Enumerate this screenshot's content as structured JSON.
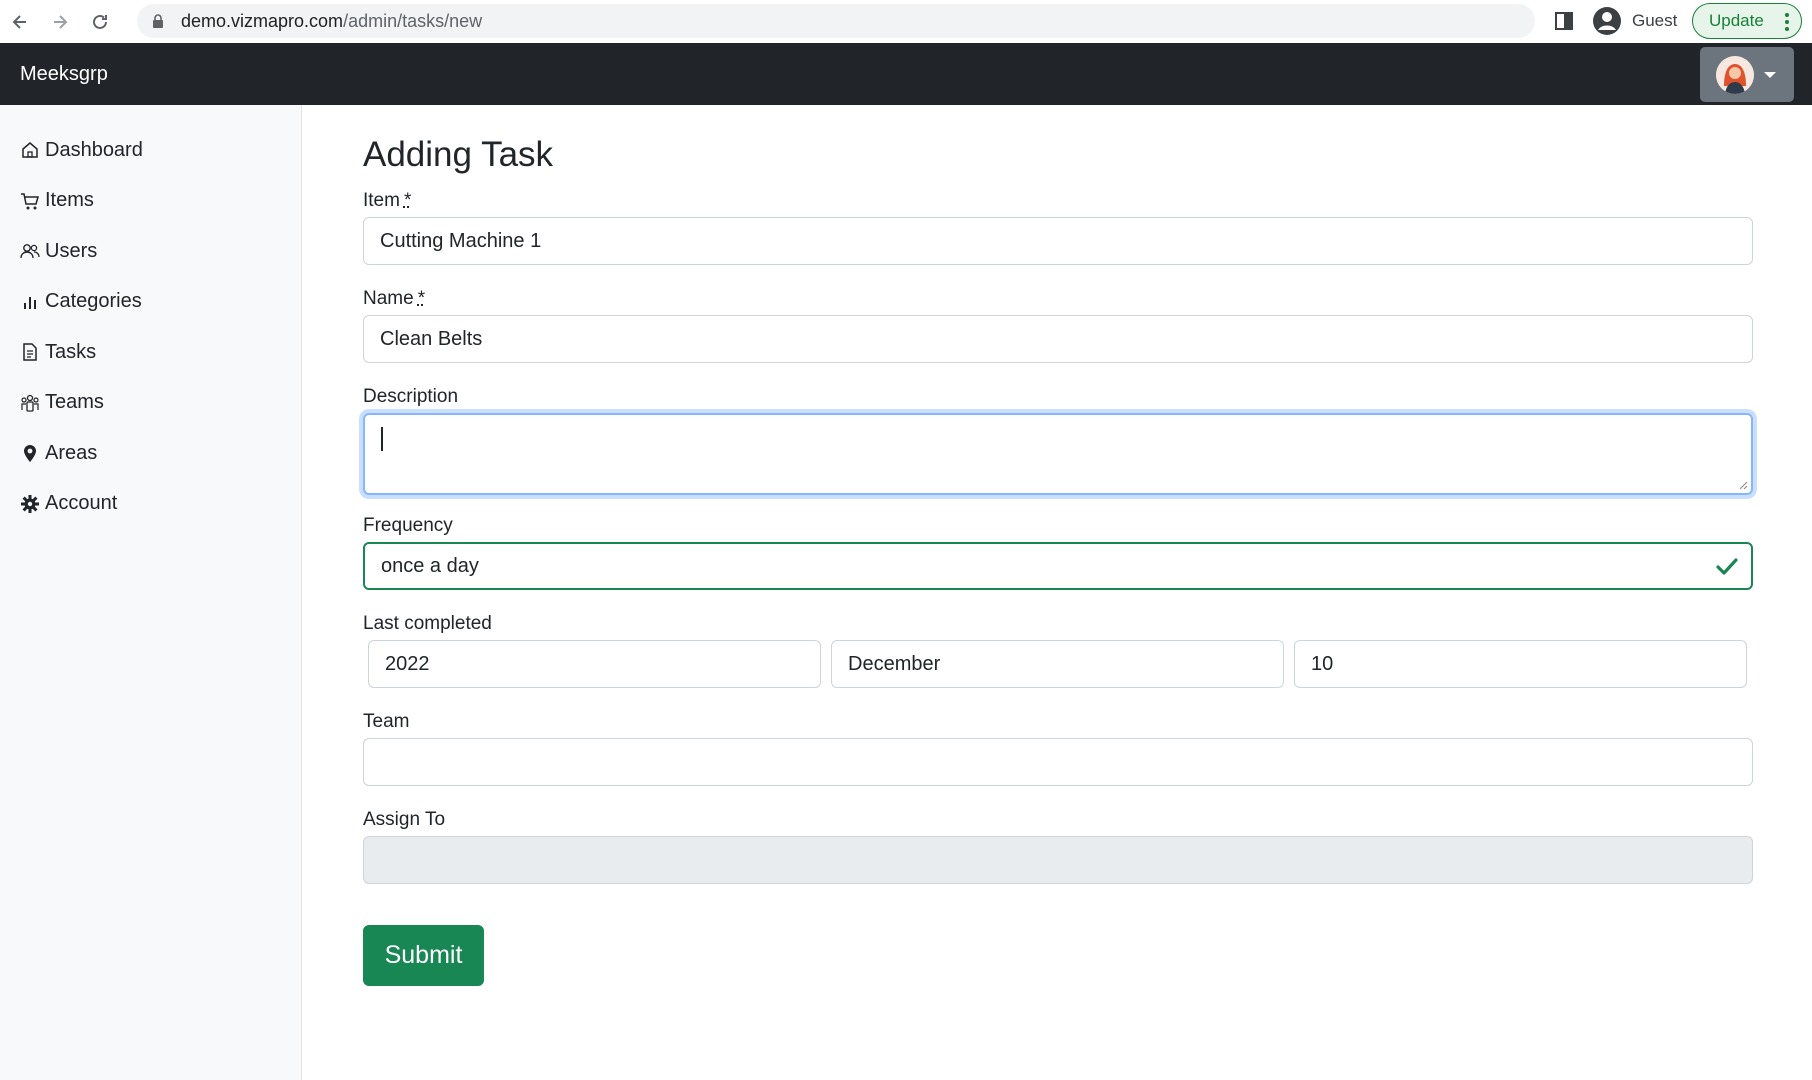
{
  "browser": {
    "url_host": "demo.vizmapro.com",
    "url_path": "/admin/tasks/new",
    "profile_label": "Guest",
    "update_label": "Update",
    "icons": [
      "back-arrow-icon",
      "forward-arrow-icon",
      "reload-icon",
      "lock-icon",
      "side-panel-icon",
      "profile-icon",
      "kebab-menu-icon"
    ]
  },
  "navbar": {
    "brand": "Meeksgrp",
    "user_menu_icon": "avatar"
  },
  "sidebar": {
    "items": [
      {
        "label": "Dashboard",
        "icon": "house-icon"
      },
      {
        "label": "Items",
        "icon": "cart-icon"
      },
      {
        "label": "Users",
        "icon": "people-icon"
      },
      {
        "label": "Categories",
        "icon": "bar-chart-icon"
      },
      {
        "label": "Tasks",
        "icon": "file-text-icon"
      },
      {
        "label": "Teams",
        "icon": "team-icon"
      },
      {
        "label": "Areas",
        "icon": "map-pin-icon"
      },
      {
        "label": "Account",
        "icon": "gear-icon"
      }
    ]
  },
  "form": {
    "title": "Adding Task",
    "item": {
      "label": "Item",
      "required_mark": "*",
      "value": "Cutting Machine 1"
    },
    "name": {
      "label": "Name",
      "required_mark": "*",
      "value": "Clean Belts"
    },
    "description": {
      "label": "Description",
      "value": ""
    },
    "frequency": {
      "label": "Frequency",
      "value": "once a day"
    },
    "last_completed": {
      "label": "Last completed",
      "year": "2022",
      "month": "December",
      "day": "10"
    },
    "team": {
      "label": "Team",
      "value": ""
    },
    "assign_to": {
      "label": "Assign To",
      "value": ""
    },
    "submit_label": "Submit"
  },
  "colors": {
    "navbar_bg": "#212529",
    "sidebar_bg": "#f8f9fa",
    "success": "#198754",
    "focus_ring": "#86b7fe",
    "disabled_bg": "#e9ecef"
  }
}
